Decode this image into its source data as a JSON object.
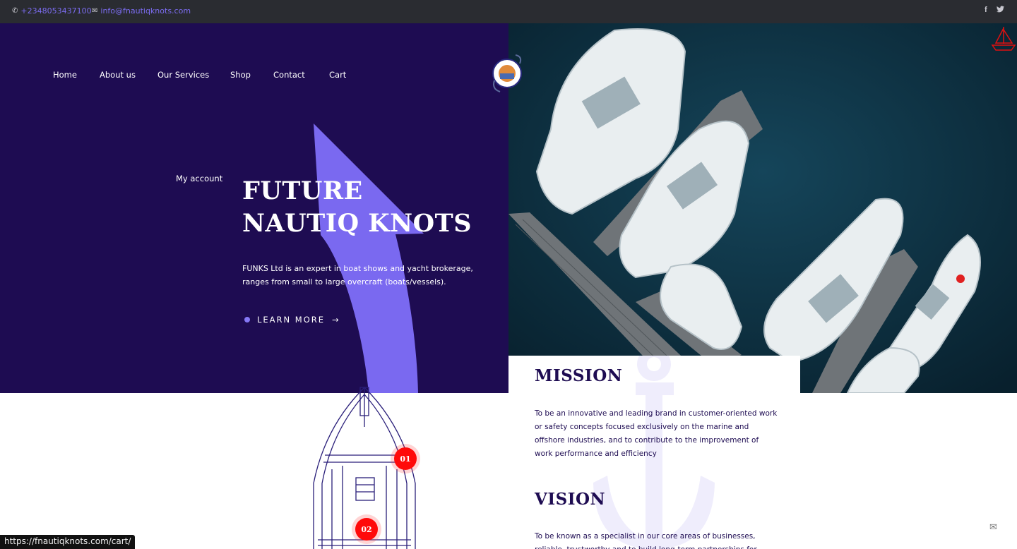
{
  "topbar": {
    "phone": "+2348053437100",
    "email": "info@fnautiqknots.com",
    "icons": {
      "phone": "phone-icon",
      "email": "envelope-icon",
      "facebook": "facebook-icon",
      "twitter": "twitter-icon"
    }
  },
  "nav": {
    "items": [
      "Home",
      "About us",
      "Our Services",
      "Shop",
      "Contact",
      "Cart"
    ],
    "account": "My account"
  },
  "hero": {
    "title": "FUTURE NAUTIQ KNOTS",
    "description": "FUNKS Ltd is an expert in boat shows and yacht brokerage, ranges from small to large overcraft (boats/vessels).",
    "cta": "LEARN MORE",
    "cta_arrow": "→"
  },
  "boat_markers": [
    "01",
    "02"
  ],
  "mission": {
    "heading": "MISSION",
    "text": "To be an innovative and leading brand in customer-oriented work or safety concepts focused exclusively on the marine and offshore industries, and to contribute to the improvement of work performance and efficiency"
  },
  "vision": {
    "heading": "VISION",
    "text": "To be known as a specialist in our core areas of businesses, reliable, trustworthy and to build long-term partnerships for"
  },
  "status_bar": {
    "url": "https://fnautiqknots.com/cart/"
  },
  "colors": {
    "topbar": "#2a2c31",
    "hero_bg": "#1e0c52",
    "accent": "#7b6cf0",
    "marker": "#ff0a0a",
    "heading": "#1e0c52"
  }
}
